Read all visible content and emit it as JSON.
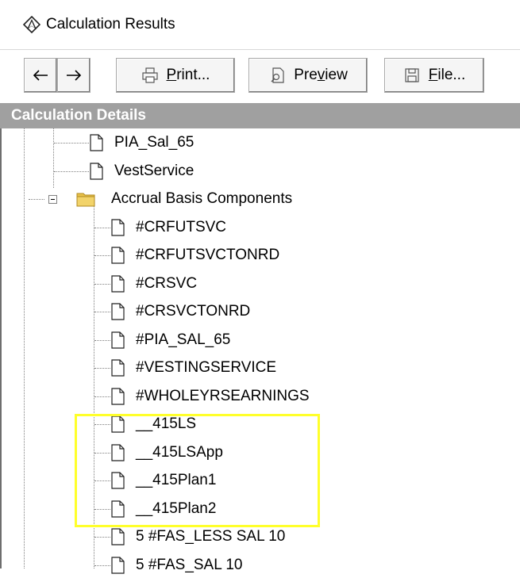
{
  "window": {
    "title": "Calculation Results",
    "app_icon": "compass-logo-icon"
  },
  "toolbar": {
    "back_icon": "arrow-left-icon",
    "forward_icon": "arrow-right-icon",
    "print_label_pre": "",
    "print_label_ul": "P",
    "print_label_post": "rint...",
    "preview_label_pre": "Pre",
    "preview_label_ul": "v",
    "preview_label_post": "iew",
    "file_label_pre": "",
    "file_label_ul": "F",
    "file_label_post": "ile..."
  },
  "header": {
    "title": "Calculation Details"
  },
  "tree": {
    "items_top": [
      "PIA_Sal_65",
      "VestService"
    ],
    "folder": {
      "label": "Accrual Basis Components",
      "icon": "folder-icon",
      "expanded": true
    },
    "children": [
      "#CRFUTSVC",
      "#CRFUTSVCTONRD",
      "#CRSVC",
      "#CRSVCTONRD",
      "#PIA_SAL_65",
      "#VESTINGSERVICE",
      "#WHOLEYRSEARNINGS",
      "__415LS",
      "__415LSApp",
      "__415Plan1",
      "__415Plan2",
      "5 #FAS_LESS SAL 10",
      "5 #FAS_SAL 10"
    ]
  },
  "colors": {
    "header_bg": "#a0a0a0",
    "highlight": "#ffff2a",
    "folder": "#e8c14a"
  }
}
